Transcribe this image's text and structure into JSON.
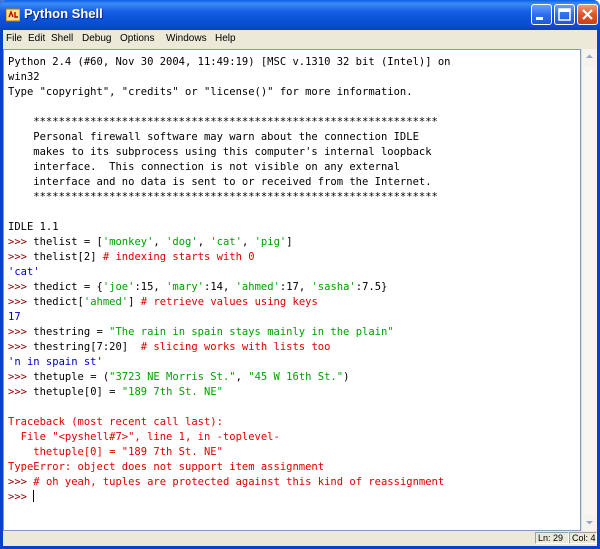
{
  "window": {
    "title": "Python Shell",
    "icon": "python-idle-icon",
    "buttons": [
      "minimize-icon",
      "maximize-icon",
      "close-icon"
    ]
  },
  "menu": {
    "items": [
      "File",
      "Edit",
      "Shell",
      "Debug",
      "Options",
      "Windows",
      "Help"
    ]
  },
  "colors": {
    "prompt": "#8b0000",
    "string": "#00a000",
    "comment": "#dd0000",
    "output": "#0000c0",
    "error": "#e00000"
  },
  "shell": {
    "lines": [
      {
        "segs": [
          {
            "t": "Python 2.4 (#60, Nov 30 2004, 11:49:19) [MSC v.1310 32 bit (Intel)] on",
            "c": "def"
          }
        ]
      },
      {
        "segs": [
          {
            "t": "win32",
            "c": "def"
          }
        ]
      },
      {
        "segs": [
          {
            "t": "Type \"copyright\", \"credits\" or \"license()\" for more information.",
            "c": "def"
          }
        ]
      },
      {
        "segs": [
          {
            "t": "",
            "c": "def"
          }
        ]
      },
      {
        "segs": [
          {
            "t": "    ****************************************************************",
            "c": "def"
          }
        ]
      },
      {
        "segs": [
          {
            "t": "    Personal firewall software may warn about the connection IDLE",
            "c": "def"
          }
        ]
      },
      {
        "segs": [
          {
            "t": "    makes to its subprocess using this computer's internal loopback",
            "c": "def"
          }
        ]
      },
      {
        "segs": [
          {
            "t": "    interface.  This connection is not visible on any external",
            "c": "def"
          }
        ]
      },
      {
        "segs": [
          {
            "t": "    interface and no data is sent to or received from the Internet.",
            "c": "def"
          }
        ]
      },
      {
        "segs": [
          {
            "t": "    ****************************************************************",
            "c": "def"
          }
        ]
      },
      {
        "segs": [
          {
            "t": "",
            "c": "def"
          }
        ]
      },
      {
        "segs": [
          {
            "t": "IDLE 1.1",
            "c": "def"
          }
        ]
      },
      {
        "segs": [
          {
            "t": ">>> ",
            "c": "prompt"
          },
          {
            "t": "thelist = [",
            "c": "def"
          },
          {
            "t": "'monkey'",
            "c": "str"
          },
          {
            "t": ", ",
            "c": "def"
          },
          {
            "t": "'dog'",
            "c": "str"
          },
          {
            "t": ", ",
            "c": "def"
          },
          {
            "t": "'cat'",
            "c": "str"
          },
          {
            "t": ", ",
            "c": "def"
          },
          {
            "t": "'pig'",
            "c": "str"
          },
          {
            "t": "]",
            "c": "def"
          }
        ]
      },
      {
        "segs": [
          {
            "t": ">>> ",
            "c": "prompt"
          },
          {
            "t": "thelist[2] ",
            "c": "def"
          },
          {
            "t": "# indexing starts with 0",
            "c": "cmt"
          }
        ]
      },
      {
        "segs": [
          {
            "t": "'cat'",
            "c": "out"
          }
        ]
      },
      {
        "segs": [
          {
            "t": ">>> ",
            "c": "prompt"
          },
          {
            "t": "thedict = {",
            "c": "def"
          },
          {
            "t": "'joe'",
            "c": "str"
          },
          {
            "t": ":15, ",
            "c": "def"
          },
          {
            "t": "'mary'",
            "c": "str"
          },
          {
            "t": ":14, ",
            "c": "def"
          },
          {
            "t": "'ahmed'",
            "c": "str"
          },
          {
            "t": ":17, ",
            "c": "def"
          },
          {
            "t": "'sasha'",
            "c": "str"
          },
          {
            "t": ":7.5}",
            "c": "def"
          }
        ]
      },
      {
        "segs": [
          {
            "t": ">>> ",
            "c": "prompt"
          },
          {
            "t": "thedict[",
            "c": "def"
          },
          {
            "t": "'ahmed'",
            "c": "str"
          },
          {
            "t": "] ",
            "c": "def"
          },
          {
            "t": "# retrieve values using keys",
            "c": "cmt"
          }
        ]
      },
      {
        "segs": [
          {
            "t": "17",
            "c": "out"
          }
        ]
      },
      {
        "segs": [
          {
            "t": ">>> ",
            "c": "prompt"
          },
          {
            "t": "thestring = ",
            "c": "def"
          },
          {
            "t": "\"The rain in spain stays mainly in the plain\"",
            "c": "str"
          }
        ]
      },
      {
        "segs": [
          {
            "t": ">>> ",
            "c": "prompt"
          },
          {
            "t": "thestring[7:20]  ",
            "c": "def"
          },
          {
            "t": "# slicing works with lists too",
            "c": "cmt"
          }
        ]
      },
      {
        "segs": [
          {
            "t": "'n in spain st'",
            "c": "out"
          }
        ]
      },
      {
        "segs": [
          {
            "t": ">>> ",
            "c": "prompt"
          },
          {
            "t": "thetuple = (",
            "c": "def"
          },
          {
            "t": "\"3723 NE Morris St.\"",
            "c": "str"
          },
          {
            "t": ", ",
            "c": "def"
          },
          {
            "t": "\"45 W 16th St.\"",
            "c": "str"
          },
          {
            "t": ")",
            "c": "def"
          }
        ]
      },
      {
        "segs": [
          {
            "t": ">>> ",
            "c": "prompt"
          },
          {
            "t": "thetuple[0] = ",
            "c": "def"
          },
          {
            "t": "\"189 7th St. NE\"",
            "c": "str"
          }
        ]
      },
      {
        "segs": [
          {
            "t": "",
            "c": "def"
          }
        ]
      },
      {
        "segs": [
          {
            "t": "Traceback (most recent call last):",
            "c": "err"
          }
        ]
      },
      {
        "segs": [
          {
            "t": "  File \"<pyshell#7>\", line 1, in -toplevel-",
            "c": "err"
          }
        ]
      },
      {
        "segs": [
          {
            "t": "    thetuple[0] = \"189 7th St. NE\"",
            "c": "err"
          }
        ]
      },
      {
        "segs": [
          {
            "t": "TypeError: object does not support item assignment",
            "c": "err"
          }
        ]
      },
      {
        "segs": [
          {
            "t": ">>> ",
            "c": "prompt"
          },
          {
            "t": "# oh yeah, tuples are protected against this kind of reassignment",
            "c": "cmt"
          }
        ]
      },
      {
        "segs": [
          {
            "t": ">>> ",
            "c": "prompt"
          }
        ],
        "cursor": true
      }
    ]
  },
  "status": {
    "line": "Ln: 29",
    "col": "Col: 4"
  }
}
